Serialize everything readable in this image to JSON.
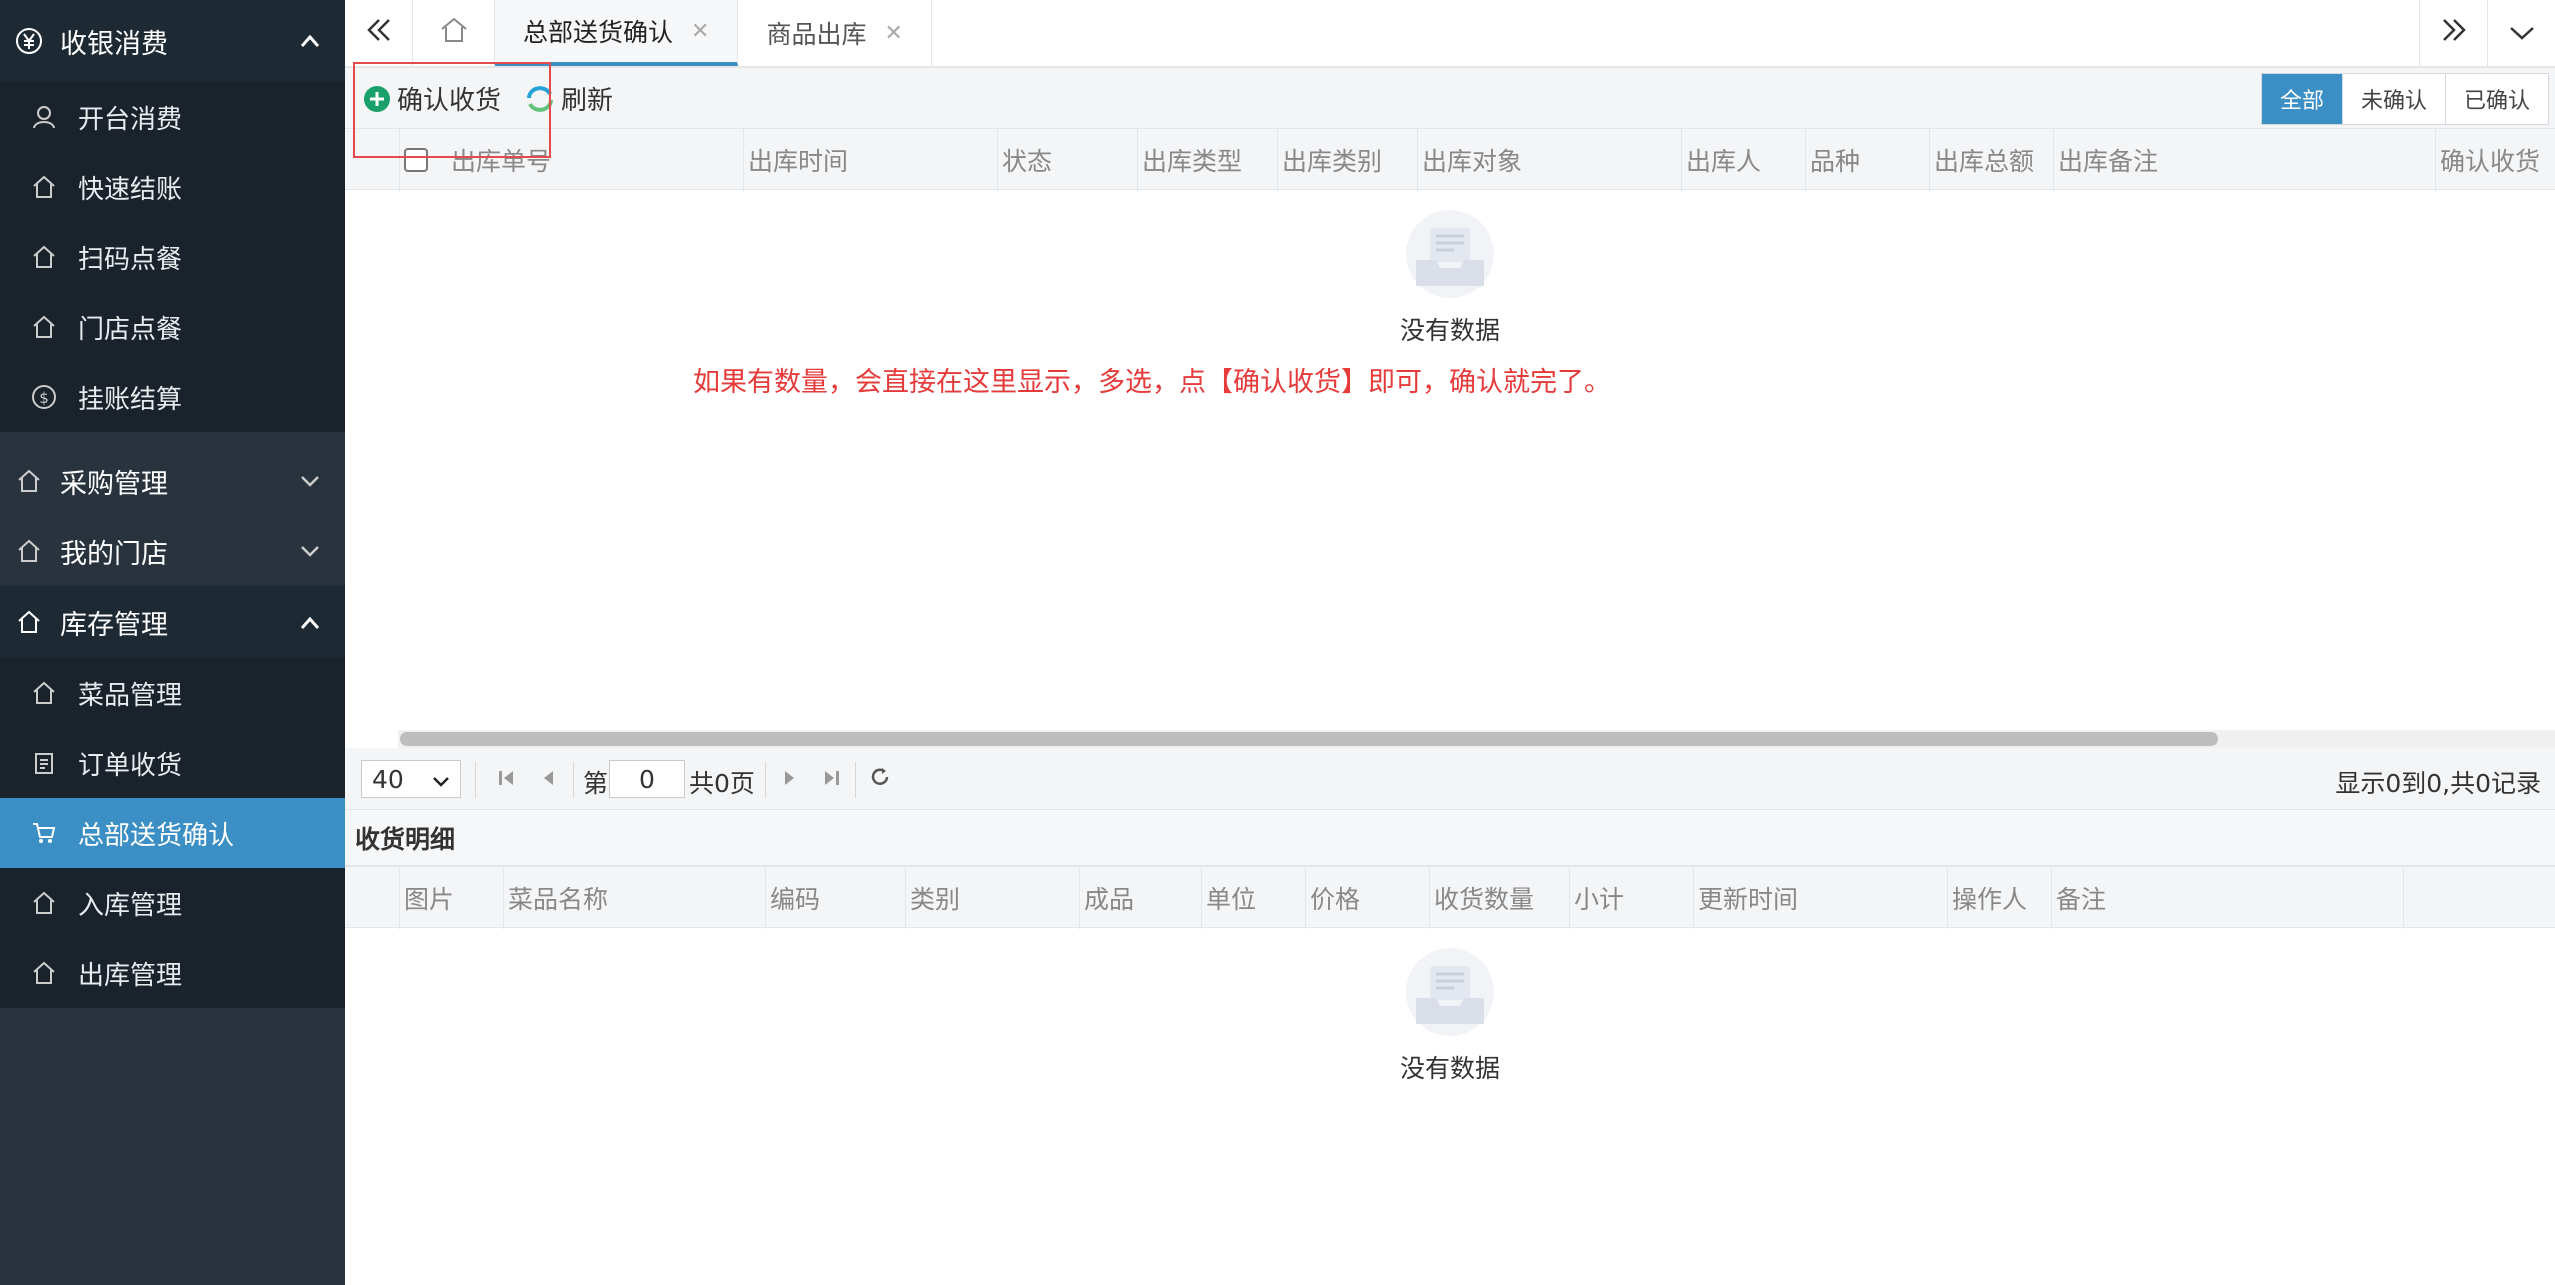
{
  "sidebar": {
    "groups": [
      {
        "label": "收银消费",
        "icon": "yen-icon",
        "expanded": true,
        "items": [
          {
            "label": "开台消费",
            "icon": "user-icon"
          },
          {
            "label": "快速结账",
            "icon": "home-icon"
          },
          {
            "label": "扫码点餐",
            "icon": "home-icon"
          },
          {
            "label": "门店点餐",
            "icon": "home-icon"
          },
          {
            "label": "挂账结算",
            "icon": "dollar-icon"
          }
        ]
      },
      {
        "label": "采购管理",
        "icon": "home-icon",
        "expanded": false
      },
      {
        "label": "我的门店",
        "icon": "home-icon",
        "expanded": false
      },
      {
        "label": "库存管理",
        "icon": "home-icon",
        "expanded": true,
        "items": [
          {
            "label": "菜品管理",
            "icon": "home-icon"
          },
          {
            "label": "订单收货",
            "icon": "clipboard-icon"
          },
          {
            "label": "总部送货确认",
            "icon": "cart-icon",
            "active": true
          },
          {
            "label": "入库管理",
            "icon": "home-icon"
          },
          {
            "label": "出库管理",
            "icon": "home-icon"
          }
        ]
      }
    ]
  },
  "tabs": [
    {
      "label": "总部送货确认",
      "active": true
    },
    {
      "label": "商品出库",
      "active": false
    }
  ],
  "toolbar": {
    "confirm_label": "确认收货",
    "refresh_label": "刷新",
    "filters": [
      "全部",
      "未确认",
      "已确认"
    ],
    "active_filter": "全部"
  },
  "main_grid": {
    "columns": [
      "出库单号",
      "出库时间",
      "状态",
      "出库类型",
      "出库类别",
      "出库对象",
      "出库人",
      "品种",
      "出库总额",
      "出库备注",
      "确认收货"
    ],
    "rows": [],
    "empty_text": "没有数据"
  },
  "annotation_text": "如果有数量，会直接在这里显示，多选，点【确认收货】即可，确认就完了。",
  "pager": {
    "page_size": "40",
    "page_prefix": "第",
    "page_value": "0",
    "page_total": "共0页",
    "info": "显示0到0,共0记录"
  },
  "detail": {
    "title": "收货明细",
    "columns": [
      "图片",
      "菜品名称",
      "编码",
      "类别",
      "成品",
      "单位",
      "价格",
      "收货数量",
      "小计",
      "更新时间",
      "操作人",
      "备注"
    ],
    "rows": [],
    "empty_text": "没有数据"
  },
  "colors": {
    "sidebar_bg": "#28333e",
    "accent": "#3b8fc4",
    "annotation": "#e63b3b"
  }
}
